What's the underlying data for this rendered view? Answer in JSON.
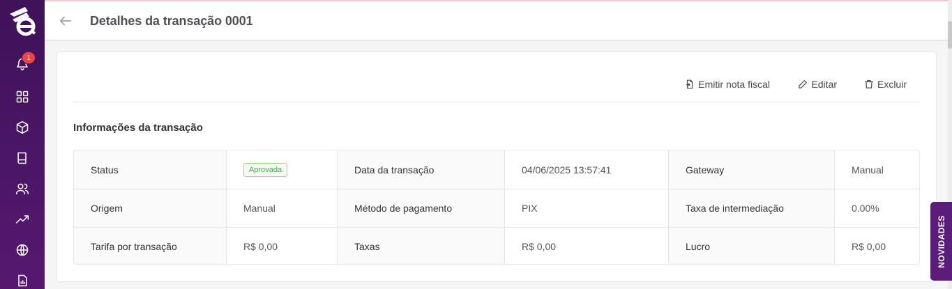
{
  "header": {
    "title": "Detalhes da transação 0001"
  },
  "notifications": {
    "count": "1"
  },
  "sidebar": {
    "icons": [
      "bell-icon",
      "grid-icon",
      "box-icon",
      "book-icon",
      "users-icon",
      "trending-up-icon",
      "globe-icon",
      "report-icon"
    ]
  },
  "actions": {
    "invoice": "Emitir nota fiscal",
    "edit": "Editar",
    "delete": "Excluir"
  },
  "section": {
    "title": "Informações da transação"
  },
  "table": {
    "rows": [
      [
        {
          "label": "Status",
          "value": "Aprovada"
        },
        {
          "label": "Data da transação",
          "value": "04/06/2025 13:57:41"
        },
        {
          "label": "Gateway",
          "value": "Manual"
        }
      ],
      [
        {
          "label": "Origem",
          "value": "Manual"
        },
        {
          "label": "Método de pagamento",
          "value": "PIX"
        },
        {
          "label": "Taxa de intermediação",
          "value": "0.00%"
        }
      ],
      [
        {
          "label": "Tarifa por transação",
          "value": "R$ 0,00"
        },
        {
          "label": "Taxas",
          "value": "R$ 0,00"
        },
        {
          "label": "Lucro",
          "value": "R$ 0,00"
        }
      ]
    ]
  },
  "novidades": {
    "label": "NOVIDADES"
  },
  "colors": {
    "sidebar": "#4a1565",
    "accent": "#5b1c7a",
    "badge_green": "#3fae46",
    "notification_red": "#ef4444"
  }
}
